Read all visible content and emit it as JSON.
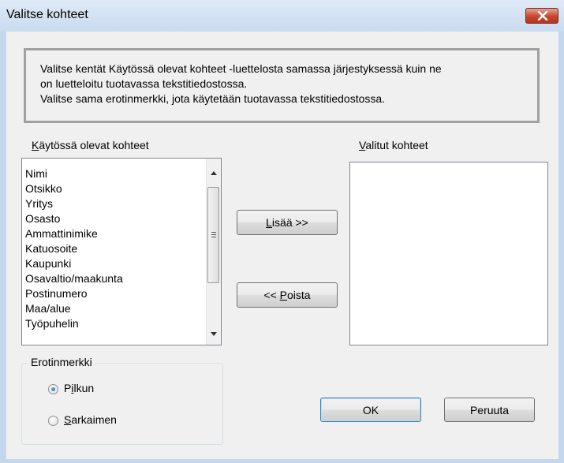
{
  "window": {
    "title": "Valitse kohteet",
    "close_icon": "close-icon"
  },
  "info": {
    "lines": [
      "Valitse kentät Käytössä olevat kohteet -luettelosta samassa järjestyksessä kuin ne",
      "on luetteloitu tuotavassa tekstitiedostossa.",
      "Valitse sama erotinmerkki, jota käytetään tuotavassa tekstitiedostossa."
    ]
  },
  "available": {
    "label_mnemonic": "K",
    "label_rest": "äytössä olevat kohteet",
    "items": [
      "Nimi",
      "Otsikko",
      "Yritys",
      "Osasto",
      "Ammattinimike",
      "Katuosoite",
      "Kaupunki",
      "Osavaltio/maakunta",
      "Postinumero",
      "Maa/alue",
      "Työpuhelin"
    ]
  },
  "selected": {
    "label_mnemonic": "V",
    "label_rest": "alitut kohteet"
  },
  "buttons": {
    "add_mnemonic": "L",
    "add_rest": "isää >>",
    "remove_prefix": "<< ",
    "remove_mnemonic": "P",
    "remove_rest": "oista",
    "ok": "OK",
    "cancel": "Peruuta"
  },
  "separator": {
    "title": "Erotinmerkki",
    "comma_pre": "P",
    "comma_mnemonic": "i",
    "comma_rest": "lkun",
    "tab_mnemonic": "S",
    "tab_rest": "arkaimen",
    "selected_option": "Pilkun"
  },
  "colors": {
    "title_bar": "#c9dbef",
    "close_button": "#c7462d",
    "dialog_bg": "#f0f0f0"
  }
}
